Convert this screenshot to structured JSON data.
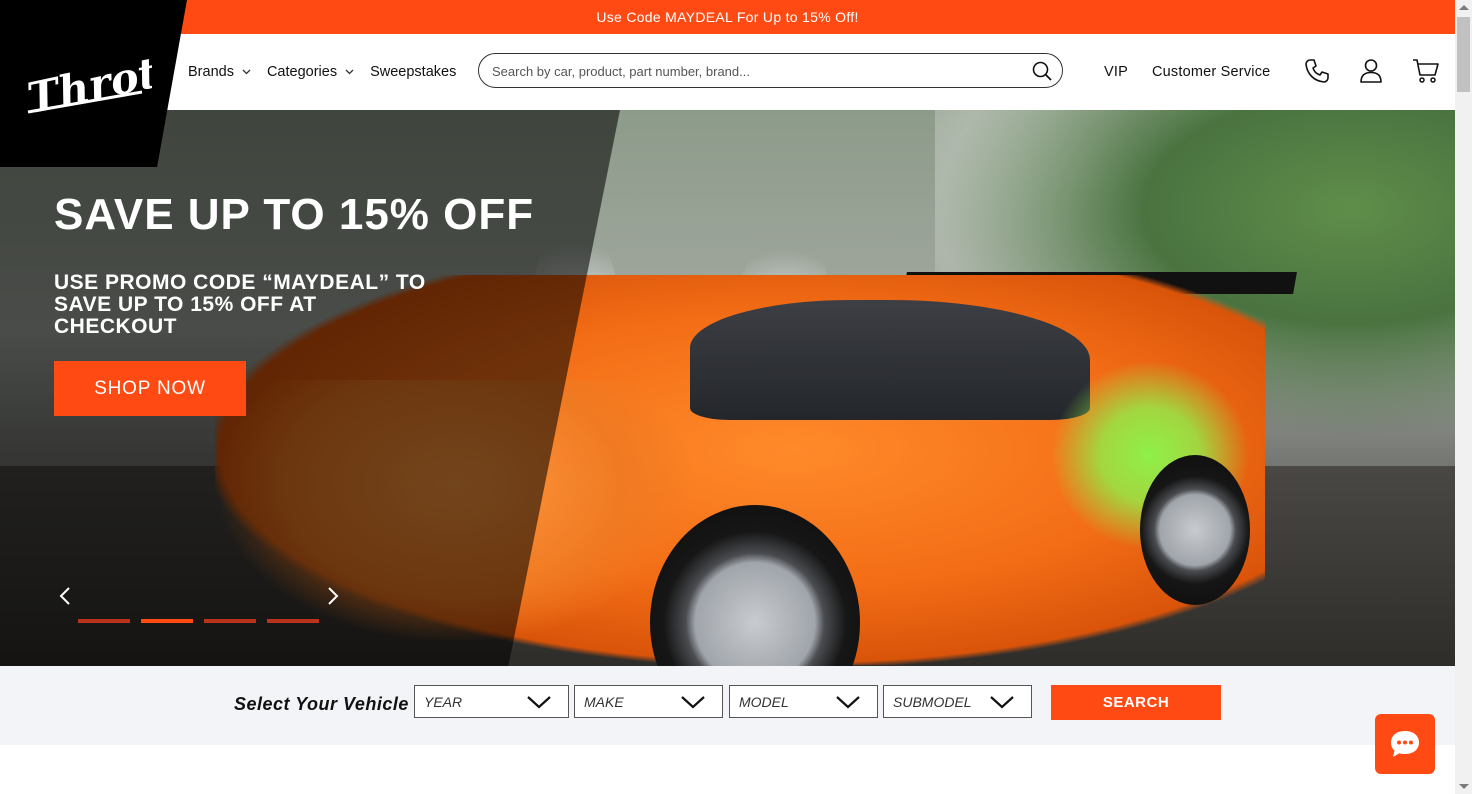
{
  "promo": {
    "text": "Use Code MAYDEAL For Up to 15% Off!"
  },
  "header": {
    "logo_text": "Throtl",
    "nav": [
      {
        "label": "Brands",
        "has_dropdown": true
      },
      {
        "label": "Categories",
        "has_dropdown": true
      },
      {
        "label": "Sweepstakes",
        "has_dropdown": false
      }
    ],
    "search": {
      "placeholder": "Search by car, product, part number, brand...",
      "icon": "search-icon"
    },
    "right_links": [
      "VIP",
      "Customer Service"
    ],
    "icons": [
      "phone-icon",
      "account-icon",
      "cart-icon"
    ]
  },
  "hero": {
    "title": "SAVE UP TO 15% OFF",
    "subtitle": "USE PROMO CODE “MAYDEAL” TO SAVE UP TO 15% OFF AT CHECKOUT",
    "cta_label": "SHOP NOW",
    "slides_count": 4,
    "active_slide": 1
  },
  "vehicle_selector": {
    "label": "Select Your Vehicle",
    "fields": [
      "YEAR",
      "MAKE",
      "MODEL",
      "SUBMODEL"
    ],
    "button_label": "SEARCH"
  },
  "colors": {
    "accent": "#ff4a14",
    "logo_bg": "#000000",
    "selector_bg": "#f2f4f7"
  }
}
